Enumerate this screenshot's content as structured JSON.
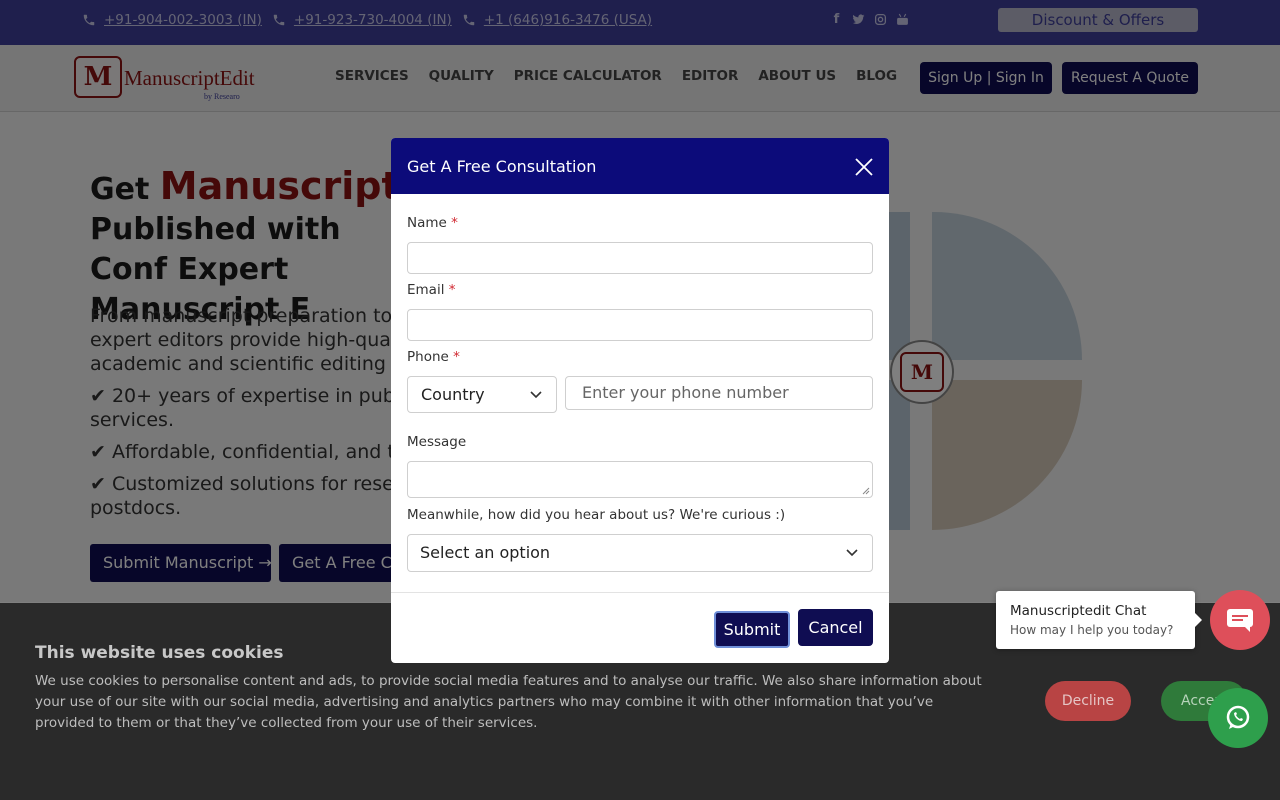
{
  "topbar": {
    "phones": [
      "+91-904-002-3003 (IN)",
      "+91-923-730-4004 (IN)",
      "+1 (646)916-3476 (USA)"
    ],
    "social_icons": [
      "facebook-icon",
      "twitter-icon",
      "instagram-icon",
      "youtube-icon"
    ],
    "discount_label": "Discount & Offers"
  },
  "nav": {
    "logo_text": "ManuscriptEdit",
    "logo_sub": "by Researo",
    "links": [
      "SERVICES",
      "QUALITY",
      "PRICE CALCULATOR",
      "EDITOR",
      "ABOUT US",
      "BLOG"
    ],
    "signup_label": "Sign Up | Sign In",
    "quote_label": "Request A Quote"
  },
  "hero": {
    "title_prefix": "Get ",
    "title_accent": "Manuscript",
    "title_rest": " Published with Conf Expert Manuscript E",
    "paragraph": "From manuscript preparation to expert editors provide high-quali academic and scientific editing s",
    "bullets": [
      "✔ 20+ years of expertise in publi services.",
      "✔ Affordable, confidential, and t",
      "✔ Customized solutions for resea postdocs."
    ],
    "submit_label": "Submit Manuscript →",
    "free_label": "Get A Free Co"
  },
  "modal": {
    "title": "Get A Free Consultation",
    "name_label": "Name",
    "email_label": "Email",
    "phone_label": "Phone",
    "required_mark": "*",
    "country_value": "Country",
    "phone_placeholder": "Enter your phone number",
    "message_label": "Message",
    "source_label": "Meanwhile, how did you hear about us? We're curious :)",
    "source_value": "Select an option",
    "submit_label": "Submit",
    "cancel_label": "Cancel"
  },
  "cookie": {
    "title": "This website uses cookies",
    "text": "We use cookies to personalise content and ads, to provide social media features and to analyse our traffic. We also share information about your use of our site with our social media, advertising and analytics partners who may combine it with other information that you’ve provided to them or that they’ve collected from your use of their services.",
    "decline_label": "Decline",
    "accept_label": "Accept"
  },
  "chat": {
    "title": "Manuscriptedit Chat",
    "subtitle": "How may I help you today?"
  },
  "colors": {
    "brand_navy": "#0f0d52",
    "modal_header": "#0c0b7a",
    "brand_red": "#8b1212",
    "topbar": "#3f3f9a"
  }
}
